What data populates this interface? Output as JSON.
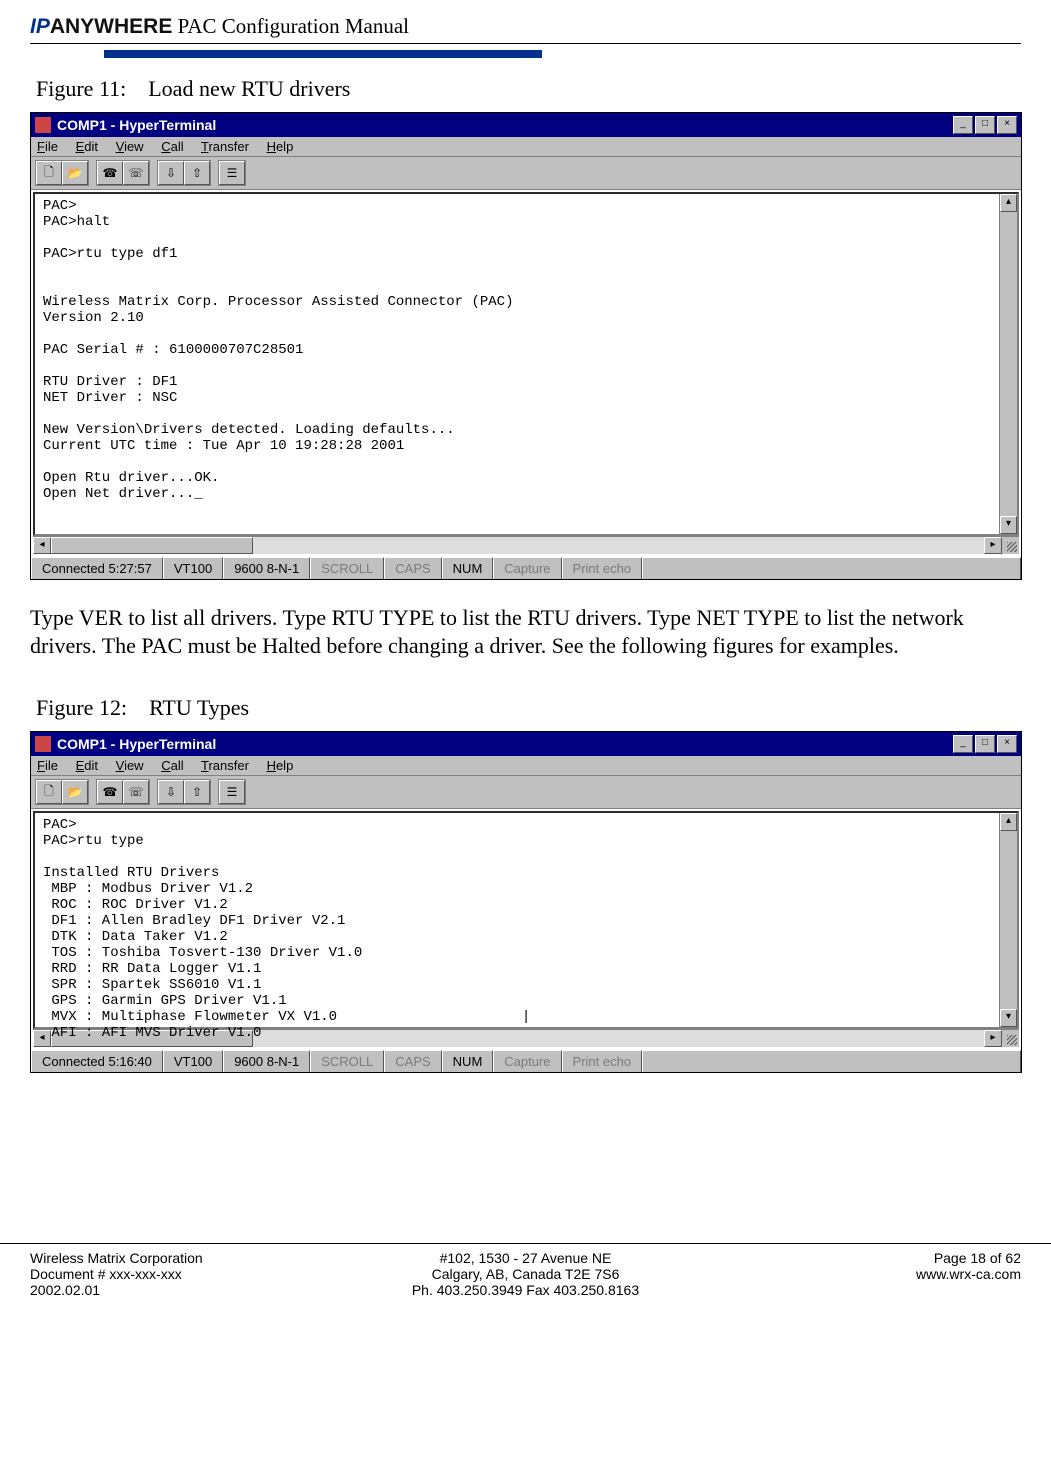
{
  "header": {
    "logo_ip": "IP",
    "logo_rest": "ANYWHERE",
    "doc_title": " PAC Configuration Manual"
  },
  "fig11": {
    "caption_num": "Figure 11:",
    "caption_txt": "Load new RTU drivers",
    "win_title": "COMP1 - HyperTerminal",
    "menu": {
      "file": "File",
      "edit": "Edit",
      "view": "View",
      "call": "Call",
      "transfer": "Transfer",
      "help": "Help"
    },
    "term": "PAC>\nPAC>halt\n\nPAC>rtu type df1\n\n\nWireless Matrix Corp. Processor Assisted Connector (PAC)\nVersion 2.10\n\nPAC Serial # : 6100000707C28501\n\nRTU Driver : DF1\nNET Driver : NSC\n\nNew Version\\Drivers detected. Loading defaults...\nCurrent UTC time : Tue Apr 10 19:28:28 2001\n\nOpen Rtu driver...OK.\nOpen Net driver..._",
    "status": {
      "conn": "Connected 5:27:57",
      "emul": "VT100",
      "port": "9600 8-N-1",
      "scroll": "SCROLL",
      "caps": "CAPS",
      "num": "NUM",
      "capt": "Capture",
      "echo": "Print echo"
    }
  },
  "para": "Type VER to list all drivers.  Type RTU TYPE to list the RTU drivers.  Type NET TYPE to list the network drivers.  The PAC must be Halted before changing a driver.  See the following figures for examples.",
  "fig12": {
    "caption_num": "Figure 12:",
    "caption_txt": "RTU Types",
    "win_title": "COMP1 - HyperTerminal",
    "menu": {
      "file": "File",
      "edit": "Edit",
      "view": "View",
      "call": "Call",
      "transfer": "Transfer",
      "help": "Help"
    },
    "term": "PAC>\nPAC>rtu type\n\nInstalled RTU Drivers\n MBP : Modbus Driver V1.2\n ROC : ROC Driver V1.2\n DF1 : Allen Bradley DF1 Driver V2.1\n DTK : Data Taker V1.2\n TOS : Toshiba Tosvert-130 Driver V1.0\n RRD : RR Data Logger V1.1\n SPR : Spartek SS6010 V1.1\n GPS : Garmin GPS Driver V1.1\n MVX : Multiphase Flowmeter VX V1.0                      |\n AFI : AFI MVS Driver V1.0",
    "status": {
      "conn": "Connected 5:16:40",
      "emul": "VT100",
      "port": "9600 8-N-1",
      "scroll": "SCROLL",
      "caps": "CAPS",
      "num": "NUM",
      "capt": "Capture",
      "echo": "Print echo"
    }
  },
  "footer": {
    "l1": "Wireless Matrix Corporation",
    "l2": "Document # xxx-xxx-xxx",
    "l3": "2002.02.01",
    "c1": "#102, 1530 - 27 Avenue NE",
    "c2": "Calgary, AB, Canada  T2E 7S6",
    "c3": "Ph. 403.250.3949  Fax 403.250.8163",
    "r1": "Page 18 of 62",
    "r2": "",
    "r3": "www.wrx-ca.com"
  }
}
